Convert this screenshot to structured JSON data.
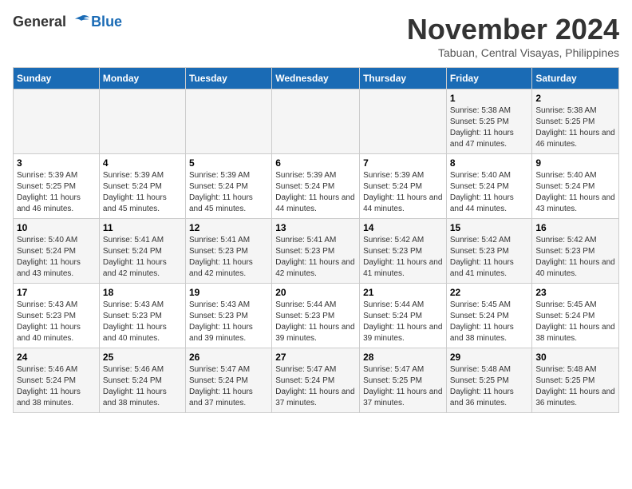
{
  "logo": {
    "line1": "General",
    "line2": "Blue"
  },
  "title": "November 2024",
  "location": "Tabuan, Central Visayas, Philippines",
  "weekdays": [
    "Sunday",
    "Monday",
    "Tuesday",
    "Wednesday",
    "Thursday",
    "Friday",
    "Saturday"
  ],
  "weeks": [
    [
      {
        "day": "",
        "info": ""
      },
      {
        "day": "",
        "info": ""
      },
      {
        "day": "",
        "info": ""
      },
      {
        "day": "",
        "info": ""
      },
      {
        "day": "",
        "info": ""
      },
      {
        "day": "1",
        "info": "Sunrise: 5:38 AM\nSunset: 5:25 PM\nDaylight: 11 hours and 47 minutes."
      },
      {
        "day": "2",
        "info": "Sunrise: 5:38 AM\nSunset: 5:25 PM\nDaylight: 11 hours and 46 minutes."
      }
    ],
    [
      {
        "day": "3",
        "info": "Sunrise: 5:39 AM\nSunset: 5:25 PM\nDaylight: 11 hours and 46 minutes."
      },
      {
        "day": "4",
        "info": "Sunrise: 5:39 AM\nSunset: 5:24 PM\nDaylight: 11 hours and 45 minutes."
      },
      {
        "day": "5",
        "info": "Sunrise: 5:39 AM\nSunset: 5:24 PM\nDaylight: 11 hours and 45 minutes."
      },
      {
        "day": "6",
        "info": "Sunrise: 5:39 AM\nSunset: 5:24 PM\nDaylight: 11 hours and 44 minutes."
      },
      {
        "day": "7",
        "info": "Sunrise: 5:39 AM\nSunset: 5:24 PM\nDaylight: 11 hours and 44 minutes."
      },
      {
        "day": "8",
        "info": "Sunrise: 5:40 AM\nSunset: 5:24 PM\nDaylight: 11 hours and 44 minutes."
      },
      {
        "day": "9",
        "info": "Sunrise: 5:40 AM\nSunset: 5:24 PM\nDaylight: 11 hours and 43 minutes."
      }
    ],
    [
      {
        "day": "10",
        "info": "Sunrise: 5:40 AM\nSunset: 5:24 PM\nDaylight: 11 hours and 43 minutes."
      },
      {
        "day": "11",
        "info": "Sunrise: 5:41 AM\nSunset: 5:24 PM\nDaylight: 11 hours and 42 minutes."
      },
      {
        "day": "12",
        "info": "Sunrise: 5:41 AM\nSunset: 5:23 PM\nDaylight: 11 hours and 42 minutes."
      },
      {
        "day": "13",
        "info": "Sunrise: 5:41 AM\nSunset: 5:23 PM\nDaylight: 11 hours and 42 minutes."
      },
      {
        "day": "14",
        "info": "Sunrise: 5:42 AM\nSunset: 5:23 PM\nDaylight: 11 hours and 41 minutes."
      },
      {
        "day": "15",
        "info": "Sunrise: 5:42 AM\nSunset: 5:23 PM\nDaylight: 11 hours and 41 minutes."
      },
      {
        "day": "16",
        "info": "Sunrise: 5:42 AM\nSunset: 5:23 PM\nDaylight: 11 hours and 40 minutes."
      }
    ],
    [
      {
        "day": "17",
        "info": "Sunrise: 5:43 AM\nSunset: 5:23 PM\nDaylight: 11 hours and 40 minutes."
      },
      {
        "day": "18",
        "info": "Sunrise: 5:43 AM\nSunset: 5:23 PM\nDaylight: 11 hours and 40 minutes."
      },
      {
        "day": "19",
        "info": "Sunrise: 5:43 AM\nSunset: 5:23 PM\nDaylight: 11 hours and 39 minutes."
      },
      {
        "day": "20",
        "info": "Sunrise: 5:44 AM\nSunset: 5:23 PM\nDaylight: 11 hours and 39 minutes."
      },
      {
        "day": "21",
        "info": "Sunrise: 5:44 AM\nSunset: 5:24 PM\nDaylight: 11 hours and 39 minutes."
      },
      {
        "day": "22",
        "info": "Sunrise: 5:45 AM\nSunset: 5:24 PM\nDaylight: 11 hours and 38 minutes."
      },
      {
        "day": "23",
        "info": "Sunrise: 5:45 AM\nSunset: 5:24 PM\nDaylight: 11 hours and 38 minutes."
      }
    ],
    [
      {
        "day": "24",
        "info": "Sunrise: 5:46 AM\nSunset: 5:24 PM\nDaylight: 11 hours and 38 minutes."
      },
      {
        "day": "25",
        "info": "Sunrise: 5:46 AM\nSunset: 5:24 PM\nDaylight: 11 hours and 38 minutes."
      },
      {
        "day": "26",
        "info": "Sunrise: 5:47 AM\nSunset: 5:24 PM\nDaylight: 11 hours and 37 minutes."
      },
      {
        "day": "27",
        "info": "Sunrise: 5:47 AM\nSunset: 5:24 PM\nDaylight: 11 hours and 37 minutes."
      },
      {
        "day": "28",
        "info": "Sunrise: 5:47 AM\nSunset: 5:25 PM\nDaylight: 11 hours and 37 minutes."
      },
      {
        "day": "29",
        "info": "Sunrise: 5:48 AM\nSunset: 5:25 PM\nDaylight: 11 hours and 36 minutes."
      },
      {
        "day": "30",
        "info": "Sunrise: 5:48 AM\nSunset: 5:25 PM\nDaylight: 11 hours and 36 minutes."
      }
    ]
  ]
}
